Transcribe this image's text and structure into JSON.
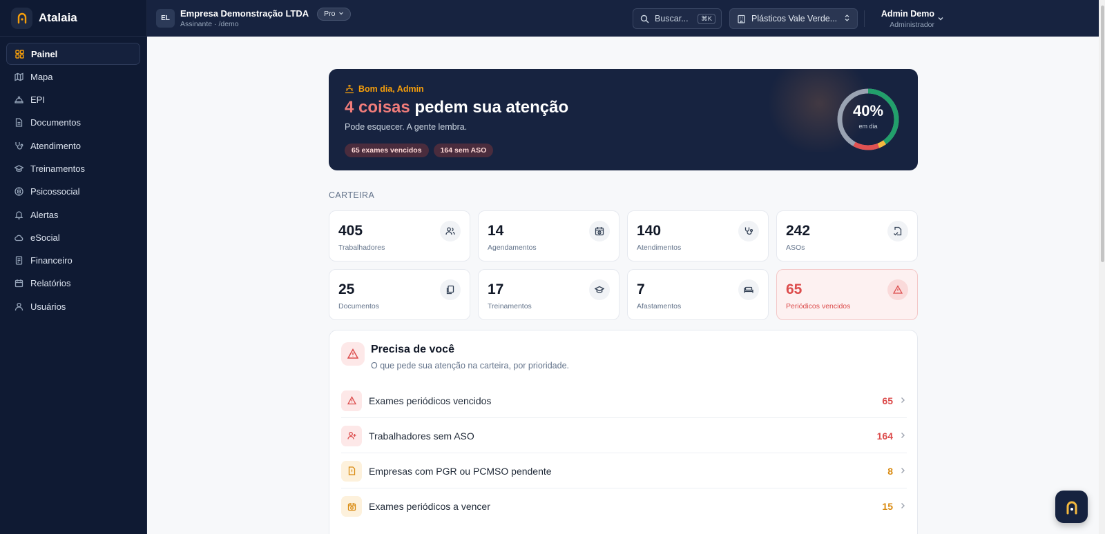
{
  "brand": {
    "name": "Atalaia"
  },
  "sidebar": {
    "items": [
      {
        "label": "Painel",
        "icon": "grid-icon"
      },
      {
        "label": "Mapa",
        "icon": "map-icon"
      },
      {
        "label": "EPI",
        "icon": "helmet-icon"
      },
      {
        "label": "Documentos",
        "icon": "document-icon"
      },
      {
        "label": "Atendimento",
        "icon": "stethoscope-icon"
      },
      {
        "label": "Treinamentos",
        "icon": "graduation-cap-icon"
      },
      {
        "label": "Psicossocial",
        "icon": "brain-icon"
      },
      {
        "label": "Alertas",
        "icon": "bell-icon"
      },
      {
        "label": "eSocial",
        "icon": "cloud-icon"
      },
      {
        "label": "Financeiro",
        "icon": "receipt-icon"
      },
      {
        "label": "Relatórios",
        "icon": "calendar-report-icon"
      },
      {
        "label": "Usuários",
        "icon": "users-icon"
      }
    ],
    "active": "Painel"
  },
  "topbar": {
    "org_initials": "EL",
    "org_name": "Empresa Demonstração LTDA",
    "org_sub": "Assinante · /demo",
    "plan": "Pro",
    "search_placeholder": "Buscar...",
    "search_shortcut": "⌘K",
    "company": "Plásticos Vale Verde...",
    "user_name": "Admin Demo",
    "user_role": "Administrador"
  },
  "hero": {
    "greeting": "Bom dia, Admin",
    "title_highlight": "4 coisas",
    "title_rest": "pedem sua atenção",
    "subtitle": "Pode esquecer. A gente lembra.",
    "tags": [
      "65 exames vencidos",
      "164 sem ASO"
    ],
    "gauge_percent": "40%",
    "gauge_caption": "em dia",
    "gauge_value": 40
  },
  "carteira": {
    "label": "CARTEIRA",
    "cards": [
      {
        "value": "405",
        "label": "Trabalhadores",
        "icon": "users-icon"
      },
      {
        "value": "14",
        "label": "Agendamentos",
        "icon": "calendar-clock-icon"
      },
      {
        "value": "140",
        "label": "Atendimentos",
        "icon": "stethoscope-icon"
      },
      {
        "value": "242",
        "label": "ASOs",
        "icon": "file-signature-icon"
      },
      {
        "value": "25",
        "label": "Documentos",
        "icon": "files-icon"
      },
      {
        "value": "17",
        "label": "Treinamentos",
        "icon": "graduation-cap-icon"
      },
      {
        "value": "7",
        "label": "Afastamentos",
        "icon": "bed-icon"
      },
      {
        "value": "65",
        "label": "Periódicos vencidos",
        "icon": "warning-icon"
      }
    ]
  },
  "attention": {
    "title": "Precisa de você",
    "subtitle": "O que pede sua atenção na carteira, por prioridade.",
    "rows": [
      {
        "label": "Exames periódicos vencidos",
        "count": "65",
        "tone": "red",
        "icon": "warning-icon"
      },
      {
        "label": "Trabalhadores sem ASO",
        "count": "164",
        "tone": "red",
        "icon": "user-plus-icon"
      },
      {
        "label": "Empresas com PGR ou PCMSO pendente",
        "count": "8",
        "tone": "amber",
        "icon": "file-alert-icon"
      },
      {
        "label": "Exames periódicos a vencer",
        "count": "15",
        "tone": "amber",
        "icon": "calendar-clock-icon"
      }
    ]
  },
  "colors": {
    "accent": "#f59e0b",
    "danger": "#dc4c4c",
    "warning": "#d98a10",
    "navy": "#172340"
  }
}
